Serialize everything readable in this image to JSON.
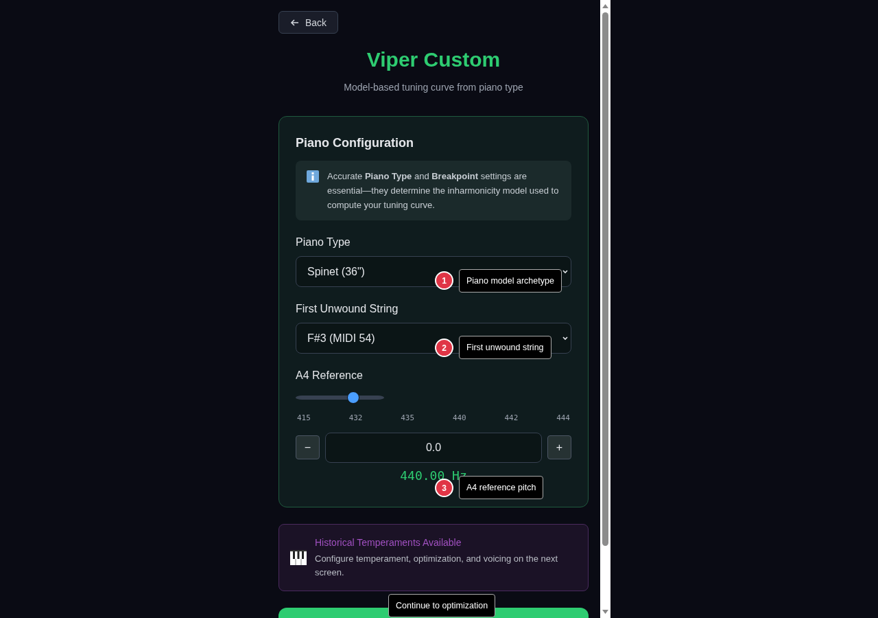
{
  "back_button": {
    "label": "Back"
  },
  "title": "Viper Custom",
  "subtitle": "Model-based tuning curve from piano type",
  "config_card": {
    "heading": "Piano Configuration",
    "info": "Accurate **Piano Type** and **Breakpoint** settings are essential—they determine the inharmonicity model used to compute your tuning curve.",
    "piano_type": {
      "label": "Piano Type",
      "value": "Spinet (36\")"
    },
    "first_unwound_string": {
      "label": "First Unwound String",
      "value": "F#3 (MIDI 54)"
    },
    "a4_reference": {
      "label": "A4 Reference",
      "level": 0.65,
      "ticks": [
        "415",
        "432",
        "435",
        "440",
        "442",
        "444"
      ],
      "decrement": "−",
      "value": "0.0",
      "increment": "+",
      "reading": "440.00 Hz"
    }
  },
  "temperaments_notice": {
    "title": "Historical Temperaments Available",
    "text": "Configure temperament, optimization, and voicing on the next screen."
  },
  "callouts": [
    {
      "number": "1",
      "label": "Piano model archetype"
    },
    {
      "number": "2",
      "label": "First unwound string"
    },
    {
      "number": "3",
      "label": "A4 reference pitch"
    },
    {
      "label": "Continue to optimization"
    }
  ]
}
